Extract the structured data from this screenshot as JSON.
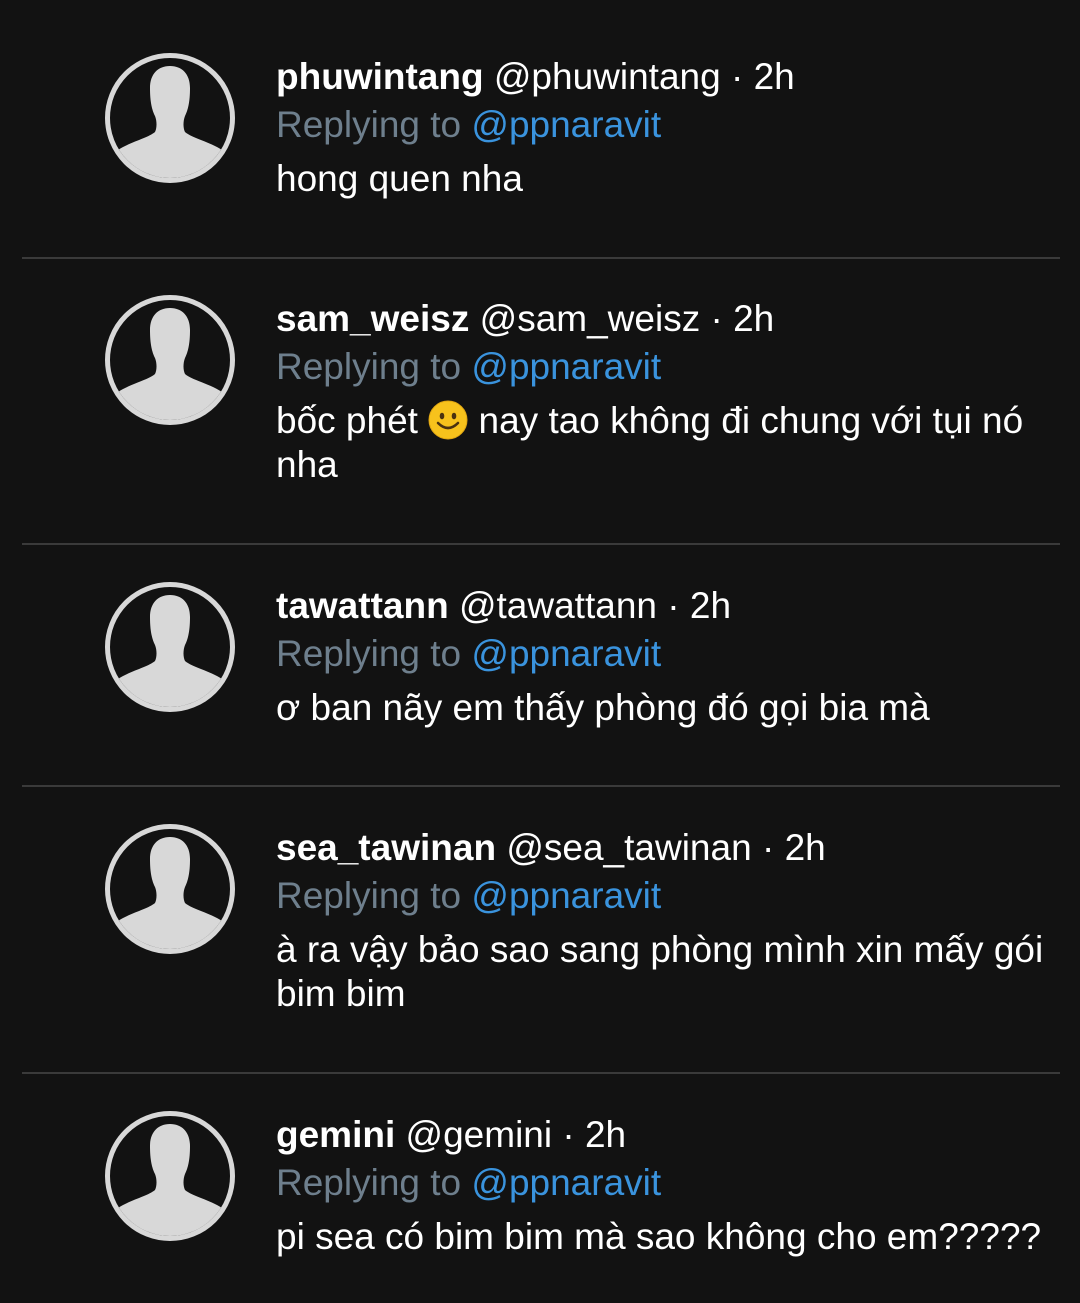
{
  "feed": {
    "tweets": [
      {
        "display_name": "phuwintang",
        "handle": "@phuwintang",
        "separator": "·",
        "time": "2h",
        "reply_prefix": "Replying to",
        "reply_to": "@ppnaravit",
        "text": "hong quen nha"
      },
      {
        "display_name": "sam_weisz",
        "handle": "@sam_weisz",
        "separator": "·",
        "time": "2h",
        "reply_prefix": "Replying to",
        "reply_to": "@ppnaravit",
        "text_before_emoji": "bốc phét",
        "emoji": "smiling-face-emoji",
        "text_after_emoji": "nay tao không đi chung với tụi nó nha"
      },
      {
        "display_name": "tawattann",
        "handle": "@tawattann",
        "separator": "·",
        "time": "2h",
        "reply_prefix": "Replying to",
        "reply_to": "@ppnaravit",
        "text": "ơ ban nãy em thấy phòng đó gọi bia mà"
      },
      {
        "display_name": "sea_tawinan",
        "handle": "@sea_tawinan",
        "separator": "·",
        "time": "2h",
        "reply_prefix": "Replying to",
        "reply_to": "@ppnaravit",
        "text": "à ra vậy bảo sao sang phòng mình xin mấy gói bim bim"
      },
      {
        "display_name": "gemini",
        "handle": "@gemini",
        "separator": "·",
        "time": "2h",
        "reply_prefix": "Replying to",
        "reply_to": "@ppnaravit",
        "text": "pi sea có bim bim mà sao không cho em?????"
      }
    ]
  },
  "colors": {
    "background": "#121212",
    "text": "#ffffff",
    "muted": "#6e7f8d",
    "link": "#3a93dd",
    "divider": "#3a3a3a",
    "avatar": "#d8d8d8"
  }
}
